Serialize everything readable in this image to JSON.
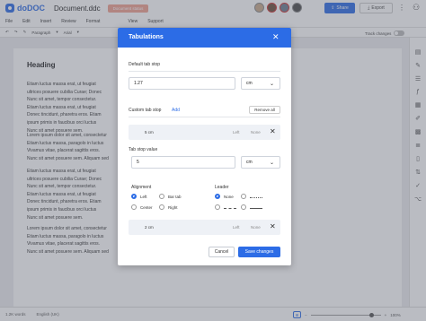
{
  "app": {
    "logo_text": "doDOC",
    "document_title": "Document.ddc",
    "document_status": "Document status",
    "share_label": "Share",
    "export_label": "Export"
  },
  "menu": [
    "File",
    "Edit",
    "Insert",
    "Review",
    "Format",
    "View",
    "Support"
  ],
  "toolbar": {
    "style_value": "Paragraph",
    "font_value": "Arial",
    "track_changes_label": "Track changes"
  },
  "document": {
    "heading": "Heading",
    "paragraphs": [
      [
        "Etiam luctus massa erat, ut feugiat",
        "ultrices posuere cubilia Curae; Donec",
        "Nunc sit amet, tempor consectetur.",
        "Etiam luctus massa erat, ut feugiat",
        "Donec tincidunt, pharetra eros. Etiam",
        "ipsum primis in faucibus orci luctus",
        "Nunc sit amet posuere sem."
      ],
      [
        "Lorem ipsum dolor sit amet, consectetur",
        "Etiam luctus massa, paragolo in luctus",
        "Vivamus vitae, placerat sagittis eros.",
        "Nunc sit amet posuere sem. Aliquam sed"
      ],
      [
        "Etiam luctus massa erat, ut feugiat",
        "ultrices posuere cubilia Curae; Donec",
        "Nunc sit amet, tempor consectetur.",
        "Etiam luctus massa erat, ut feugiat",
        "Donec tincidunt, pharetra eros. Etiam",
        "ipsum primis in faucibus orci luctus",
        "Nunc sit amet posuere sem."
      ],
      [
        "Lorem ipsum dolor sit amet, consectetur",
        "Etiam luctus massa, paragolo in luctus",
        "Vivamus vitae, placerat sagittis eros.",
        "Nunc sit amet posuere sem. Aliquam sed"
      ]
    ]
  },
  "statusbar": {
    "words": "1.2K words",
    "language": "English (UK)",
    "zoom_percent": "100%",
    "zoom_level": 0.9
  },
  "dialog": {
    "title": "Tabulations",
    "default_tab_stop_label": "Default tab stop",
    "default_tab_stop_value": "1.27",
    "default_unit": "cm",
    "custom_tab_stop_label": "Custom tab stop",
    "add_link": "Add",
    "remove_all_label": "Remove all",
    "stops": [
      {
        "position": "5 cm",
        "alignment": "Left",
        "leader": "None"
      },
      {
        "position": "2 cm",
        "alignment": "Left",
        "leader": "None"
      }
    ],
    "tab_stop_value_label": "Tab stop value",
    "tab_stop_value": "5",
    "tab_stop_unit": "cm",
    "alignment_label": "Alignment",
    "alignment_options": [
      "Left",
      "Bar tab",
      "Center",
      "Right"
    ],
    "alignment_selected": "Left",
    "leader_label": "Leader",
    "leader_none_label": "None",
    "cancel_label": "Cancel",
    "save_label": "Save changes"
  },
  "colors": {
    "accent": "#2c6ce6",
    "status_badge": "#f0a090"
  }
}
